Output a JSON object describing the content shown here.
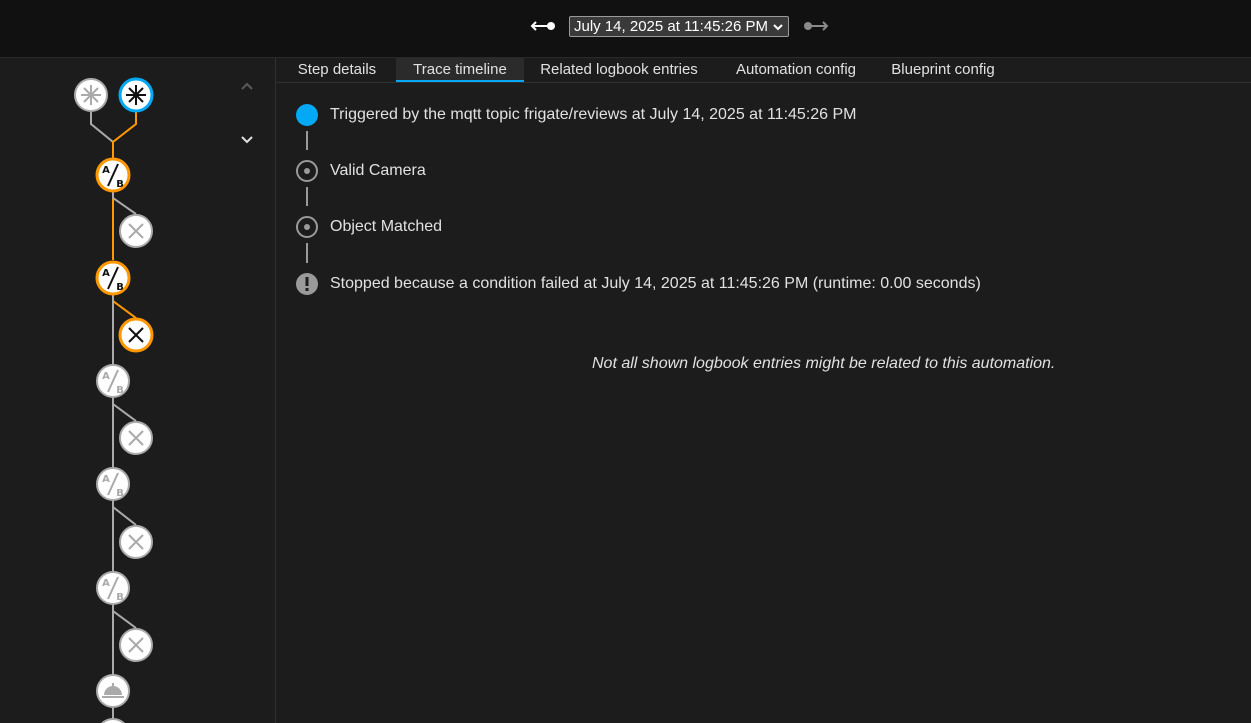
{
  "header": {
    "prev_icon": "arrow-left-icon",
    "next_icon": "arrow-right-icon",
    "selected_trace": "July 14, 2025 at 11:45:26 PM"
  },
  "tabs": [
    {
      "label": "Step details",
      "active": false
    },
    {
      "label": "Trace timeline",
      "active": true
    },
    {
      "label": "Related logbook entries",
      "active": false
    },
    {
      "label": "Automation config",
      "active": false
    },
    {
      "label": "Blueprint config",
      "active": false
    }
  ],
  "timeline": [
    {
      "text": "Triggered by the mqtt topic frigate/reviews at July 14, 2025 at 11:45:26 PM",
      "icon": "trigger-dot-icon"
    },
    {
      "text": "Valid Camera",
      "icon": "condition-dot-icon"
    },
    {
      "text": "Object Matched",
      "icon": "condition-dot-icon"
    },
    {
      "text": "Stopped because a condition failed at July 14, 2025 at 11:45:26 PM (runtime: 0.00 seconds)",
      "icon": "alert-icon"
    }
  ],
  "note": "Not all shown logbook entries might be related to this automation.",
  "graph": {
    "node_icons": [
      "asterisk-icon",
      "choose-ab-icon",
      "close-icon",
      "service-bell-icon"
    ],
    "scroll_up_icon": "chevron-up-icon",
    "scroll_down_icon": "chevron-down-icon"
  },
  "colors": {
    "accent": "#03a9f4",
    "active_path": "#ff9800",
    "inactive": "#aaaaaa",
    "background": "#1c1c1c",
    "topbar": "#111111"
  }
}
